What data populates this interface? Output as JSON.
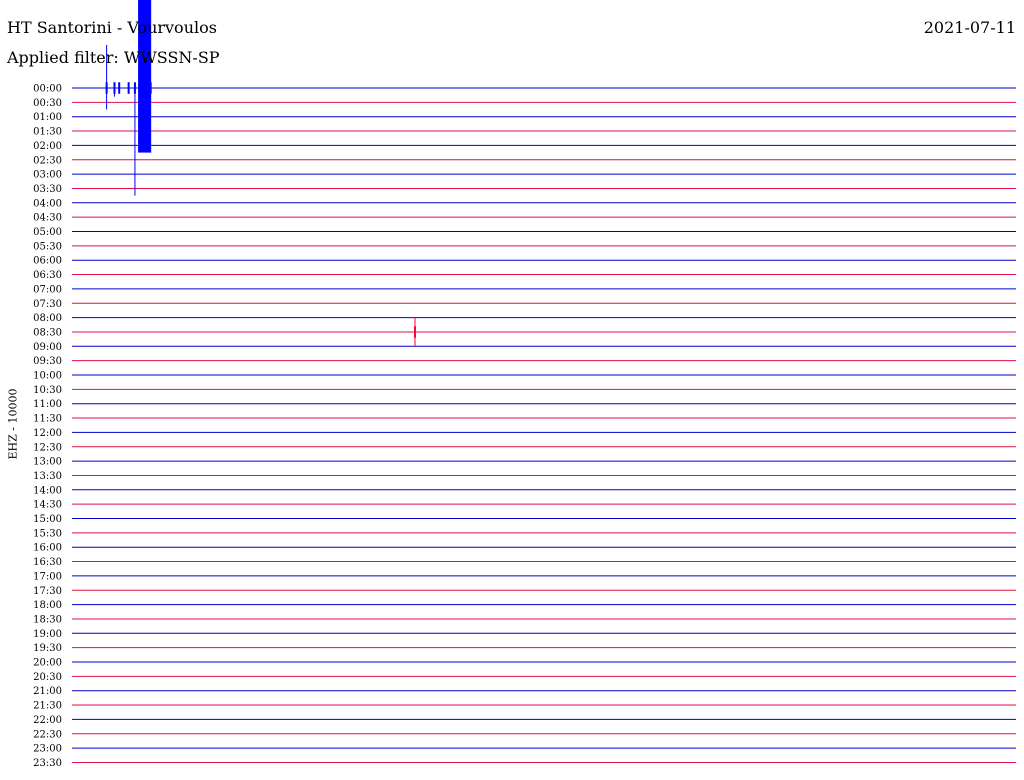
{
  "header": {
    "station": "HT Santorini - Vourvoulos",
    "filter": "Applied filter: WWSSN-SP",
    "date": "2021-07-11"
  },
  "channel_label": "EHZ - 10000",
  "colors": {
    "line_even": "#0000cc",
    "line_odd": "#dd1144",
    "trace_blue": "#0000ff",
    "trace_red": "#ff0033"
  },
  "chart_data": {
    "type": "line",
    "title": "HT Santorini - Vourvoulos",
    "subtitle": "Applied filter: WWSSN-SP",
    "date": "2021-07-11",
    "ylabel": "EHZ - 10000",
    "xlabel": "",
    "row_labels": [
      "00:00",
      "00:30",
      "01:00",
      "01:30",
      "02:00",
      "02:30",
      "03:00",
      "03:30",
      "04:00",
      "04:30",
      "05:00",
      "05:30",
      "06:00",
      "06:30",
      "07:00",
      "07:30",
      "08:00",
      "08:30",
      "09:00",
      "09:30",
      "10:00",
      "10:30",
      "11:00",
      "11:30",
      "12:00",
      "12:30",
      "13:00",
      "13:30",
      "14:00",
      "14:30",
      "15:00",
      "15:30",
      "16:00",
      "16:30",
      "17:00",
      "17:30",
      "18:00",
      "18:30",
      "19:00",
      "19:30",
      "20:00",
      "20:30",
      "21:00",
      "21:30",
      "22:00",
      "22:30",
      "23:00",
      "23:30"
    ],
    "x_range_minutes": [
      0,
      30
    ],
    "row_colors_alternate": [
      "blue",
      "red"
    ],
    "events": [
      {
        "row": "00:00",
        "minute": 1.1,
        "up_rows": 3.0,
        "down_rows": 1.5
      },
      {
        "row": "00:00",
        "minute": 1.35,
        "up_rows": 0.2,
        "down_rows": 0.6
      },
      {
        "row": "00:00",
        "minute": 1.5,
        "up_rows": 0.3,
        "down_rows": 0.3
      },
      {
        "row": "00:00",
        "minute": 1.8,
        "up_rows": 0.4,
        "down_rows": 0.4
      },
      {
        "row": "00:00",
        "minute": 2.0,
        "up_rows": 0.3,
        "down_rows": 7.5
      },
      {
        "row": "00:00",
        "minute": 2.1,
        "up_rows": 6.5,
        "down_rows": 4.5,
        "burst_width_minutes": 0.4
      },
      {
        "row": "00:00",
        "minute": 2.3,
        "up_rows": 6.5,
        "down_rows": 4.0
      },
      {
        "row": "00:00",
        "minute": 2.5,
        "up_rows": 6.5,
        "down_rows": 4.5
      },
      {
        "row": "08:30",
        "minute": 10.9,
        "up_rows": 1.0,
        "down_rows": 1.0
      }
    ]
  }
}
